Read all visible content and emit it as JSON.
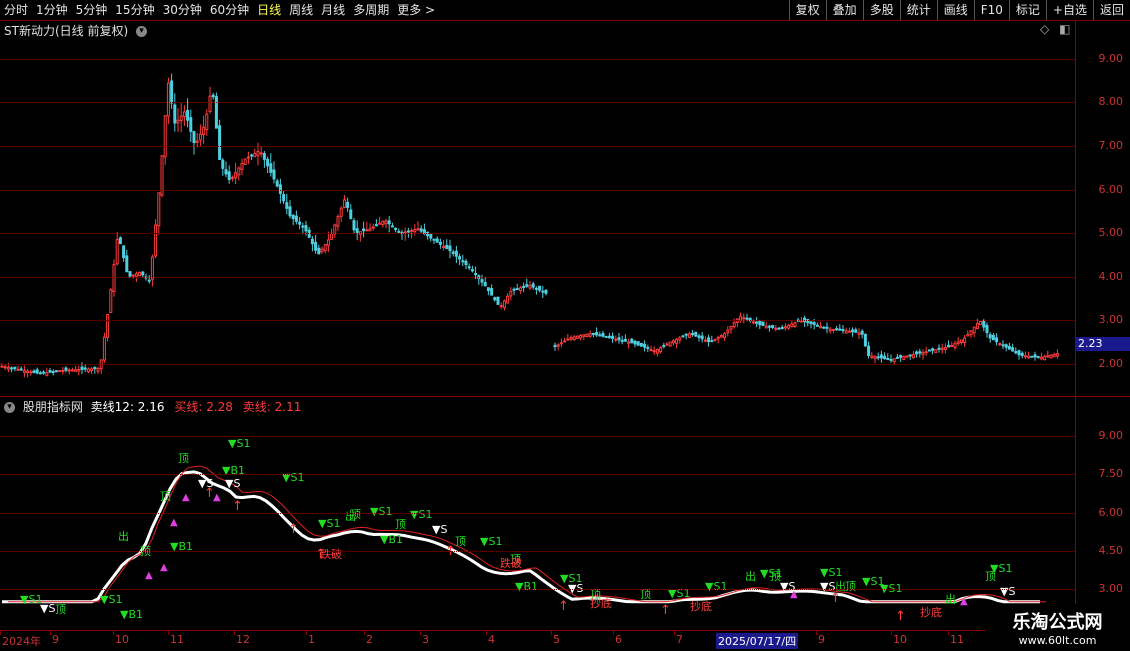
{
  "toolbar": {
    "periods": [
      "分时",
      "1分钟",
      "5分钟",
      "15分钟",
      "30分钟",
      "60分钟",
      "日线",
      "周线",
      "月线",
      "多周期",
      "更多 >"
    ],
    "active_period": "日线",
    "right_buttons": [
      "复权",
      "叠加",
      "多股",
      "统计",
      "画线",
      "F10",
      "标记",
      "+自选",
      "返回"
    ]
  },
  "main_panel": {
    "title": "ST新动力(日线 前复权)",
    "current_price": "2.23",
    "price_labels": [
      "9.00",
      "8.00",
      "7.00",
      "6.00",
      "5.00",
      "4.00",
      "3.00",
      "2.00"
    ]
  },
  "indicator_panel": {
    "name": "股朋指标网",
    "line1_label": "卖线12: 2.16",
    "line2_label": "买线: 2.28",
    "line3_label": "卖线: 2.11",
    "scale_labels": [
      "9.00",
      "7.50",
      "6.00",
      "4.50",
      "3.00"
    ]
  },
  "date_axis": {
    "labels": [
      "2024年",
      "9",
      "10",
      "11",
      "12",
      "1",
      "2",
      "3",
      "4",
      "5",
      "6",
      "7",
      "9",
      "10",
      "11"
    ],
    "highlight": "2025/07/17/四"
  },
  "signals": {
    "buy": "B1",
    "sell": "S1",
    "s": "S",
    "top": "顶",
    "out": "出",
    "cross": "跌破",
    "bottom": "抄底"
  },
  "watermark": {
    "line1": "乐淘公式网",
    "line2": "www.60lt.com"
  },
  "colors": {
    "up": "#ff3b3b",
    "down": "#4fd0e0",
    "grid": "#6b0000",
    "buy_signal": "#22dd22",
    "white_line": "#ffffff"
  }
}
